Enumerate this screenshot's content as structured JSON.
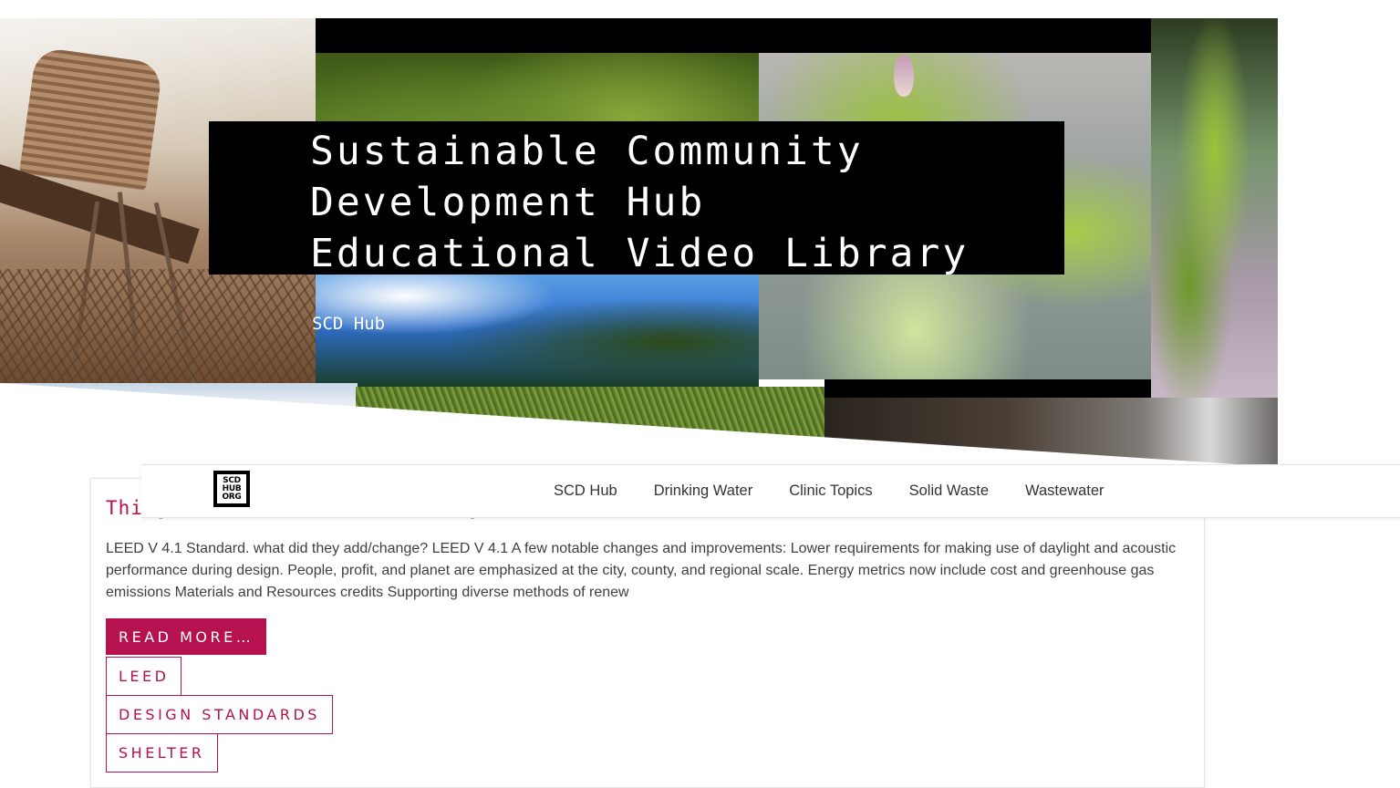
{
  "hero": {
    "title_line1": "Sustainable Community",
    "title_line2": "Development Hub",
    "title_line3": "Educational Video Library",
    "subtitle": "SCD Hub"
  },
  "nav": {
    "logo_line1": "SCD",
    "logo_line2": "HUB",
    "logo_line3": "ORG",
    "items": [
      {
        "label": "SCD Hub"
      },
      {
        "label": "Drinking Water"
      },
      {
        "label": "Clinic Topics"
      },
      {
        "label": "Solid Waste"
      },
      {
        "label": "Wastewater"
      }
    ]
  },
  "post": {
    "title_visible": "Thing",
    "title_tail_visible": "g",
    "excerpt": "LEED V 4.1 Standard. what did they add/change? LEED V 4.1 A few notable changes and improvements: Lower requirements for making use of daylight and acoustic performance during design. People, profit, and planet are emphasized at the city, county, and regional scale. Energy metrics now include cost and greenhouse gas emissions Materials and Resources credits Supporting diverse methods of renew",
    "read_more": "READ MORE…",
    "tags": [
      "LEED",
      "DESIGN STANDARDS",
      "SHELTER"
    ]
  },
  "colors": {
    "accent": "#b5124f",
    "title_box": "#000000",
    "body_text": "#3f3f3f"
  }
}
